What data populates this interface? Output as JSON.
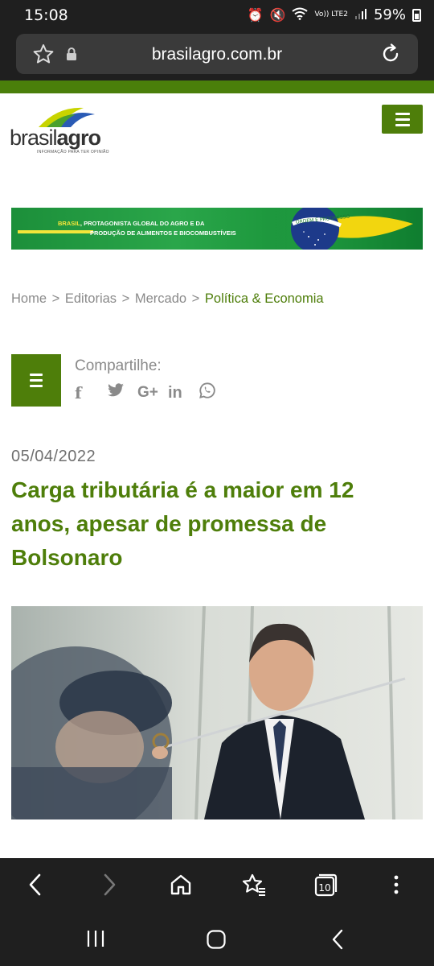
{
  "status_bar": {
    "time": "15:08",
    "network": "Vo)) LTE2",
    "battery": "59%"
  },
  "browser": {
    "url": "brasilagro.com.br",
    "tab_count": "10"
  },
  "site": {
    "logo_text_light": "brasil",
    "logo_text_bold": "agro",
    "logo_tagline": "INFORMAÇÃO PARA TER OPINIÃO"
  },
  "banner": {
    "line1_highlight": "BRASIL",
    "line1_rest": ", PROTAGONISTA GLOBAL DO AGRO E DA",
    "line2": "PRODUÇÃO DE ALIMENTOS E BIOCOMBUSTÍVEIS",
    "flag_motto": "ORDEM E PROGRESSO"
  },
  "breadcrumb": {
    "items": [
      "Home",
      "Editorias",
      "Mercado"
    ],
    "separator": ">",
    "current": "Política & Economia"
  },
  "share": {
    "label": "Compartilhe:",
    "icons": [
      "facebook-icon",
      "twitter-icon",
      "google-plus-icon",
      "linkedin-icon",
      "whatsapp-icon"
    ]
  },
  "article": {
    "date": "05/04/2022",
    "title": "Carga tributária é a maior em 12 anos, apesar de promessa de Bolsonaro"
  },
  "colors": {
    "brand_green": "#4e7e0a",
    "chrome_dark": "#1f1f1f",
    "text_gray": "#8a8a8a"
  }
}
